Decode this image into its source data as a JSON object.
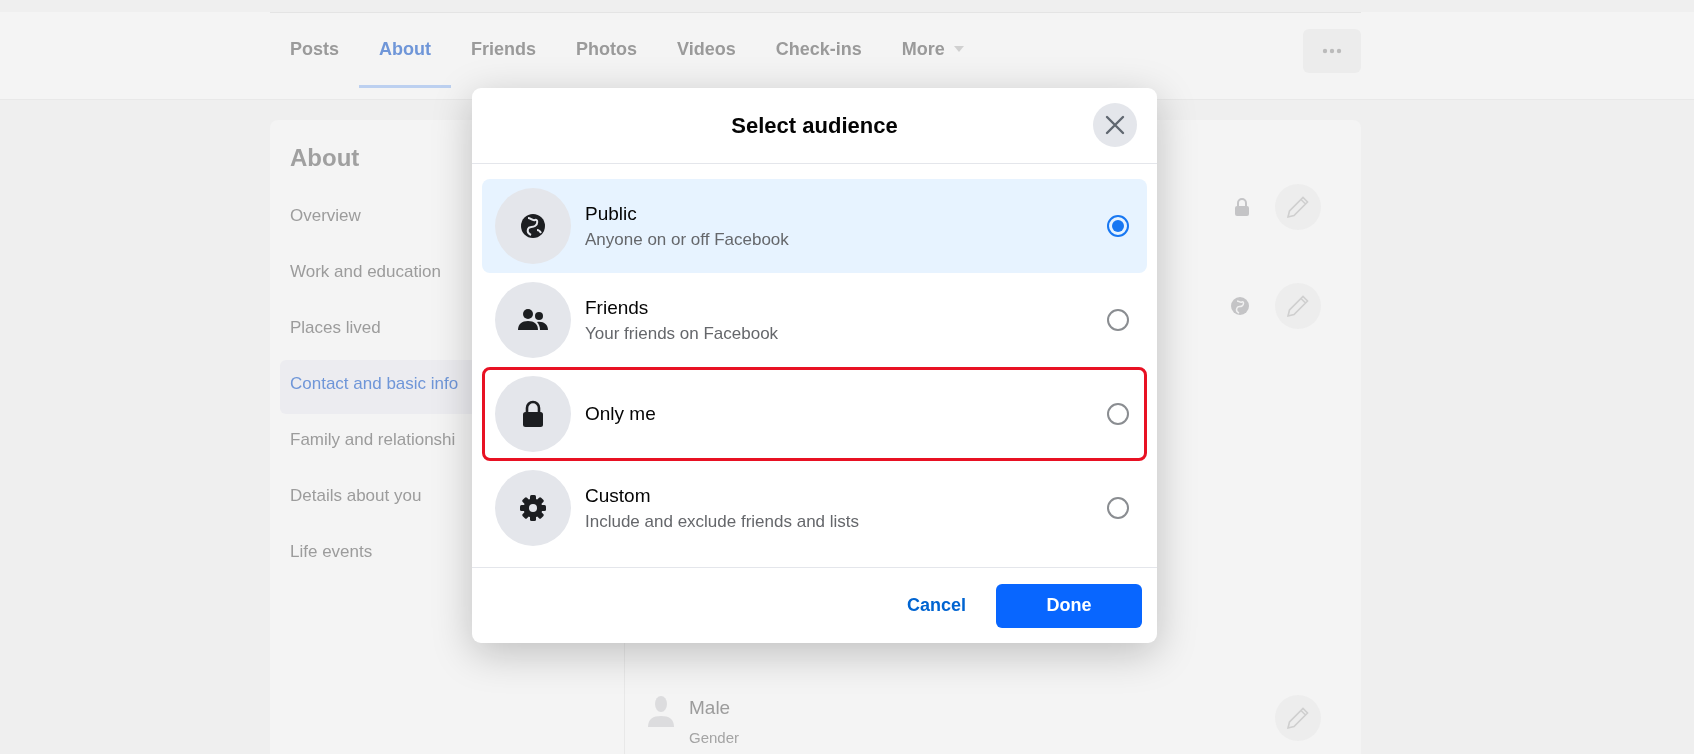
{
  "profile_tabs": [
    {
      "label": "Posts",
      "selected": false
    },
    {
      "label": "About",
      "selected": true
    },
    {
      "label": "Friends",
      "selected": false
    },
    {
      "label": "Photos",
      "selected": false
    },
    {
      "label": "Videos",
      "selected": false
    },
    {
      "label": "Check-ins",
      "selected": false
    },
    {
      "label": "More",
      "selected": false,
      "dropdown": true
    }
  ],
  "about_sidebar": {
    "title": "About",
    "items": [
      {
        "label": "Overview",
        "selected": false
      },
      {
        "label": "Work and education",
        "selected": false
      },
      {
        "label": "Places lived",
        "selected": false
      },
      {
        "label": "Contact and basic info",
        "selected": true
      },
      {
        "label": "Family and relationshi",
        "selected": false
      },
      {
        "label": "Details about you",
        "selected": false
      },
      {
        "label": "Life events",
        "selected": false
      }
    ]
  },
  "details": [
    {
      "kind": "lock"
    },
    {
      "kind": "globe"
    }
  ],
  "gender": {
    "value": "Male",
    "label": "Gender"
  },
  "dialog": {
    "title": "Select audience",
    "options": [
      {
        "kind": "globe",
        "title": "Public",
        "subtitle": "Anyone on or off Facebook",
        "selected": true,
        "highlighted": false
      },
      {
        "kind": "people",
        "title": "Friends",
        "subtitle": "Your friends on Facebook",
        "selected": false,
        "highlighted": false
      },
      {
        "kind": "lock",
        "title": "Only me",
        "selected": false,
        "highlighted": true
      },
      {
        "kind": "gear",
        "title": "Custom",
        "subtitle": "Include and exclude friends and lists",
        "selected": false,
        "highlighted": false
      }
    ],
    "cancel": "Cancel",
    "done": "Done"
  }
}
